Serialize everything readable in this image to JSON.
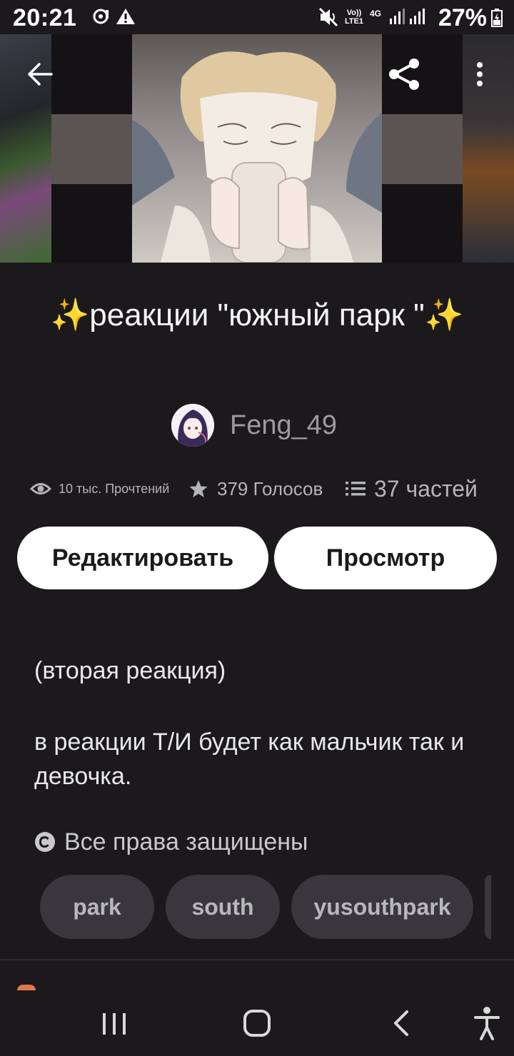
{
  "status_bar": {
    "time": "20:21",
    "network": "Vo)) LTE1",
    "network_type": "4G",
    "battery": "27%"
  },
  "app_bar": {
    "back_icon": "arrow-left-icon",
    "share_icon": "share-icon",
    "more_icon": "more-vertical-icon"
  },
  "story": {
    "title": "✨реакции \"южный парк \"✨",
    "author": "Feng_49",
    "stats": {
      "reads": "10 тыс. Прочтений",
      "votes": "379 Голосов",
      "parts": "37 частей"
    },
    "buttons": {
      "edit": "Редактировать",
      "view": "Просмотр"
    },
    "description": {
      "line1": "(вторая реакция)",
      "line2": "в реакции Т/И будет как мальчик так и девочка."
    },
    "copyright": "Все права защищены",
    "tags": [
      "park",
      "south",
      "yusouthpark"
    ]
  },
  "colors": {
    "background": "#1b191c",
    "tag_bg": "#39373b",
    "button_bg": "#ffffff",
    "muted_text": "#9b9a9f"
  }
}
